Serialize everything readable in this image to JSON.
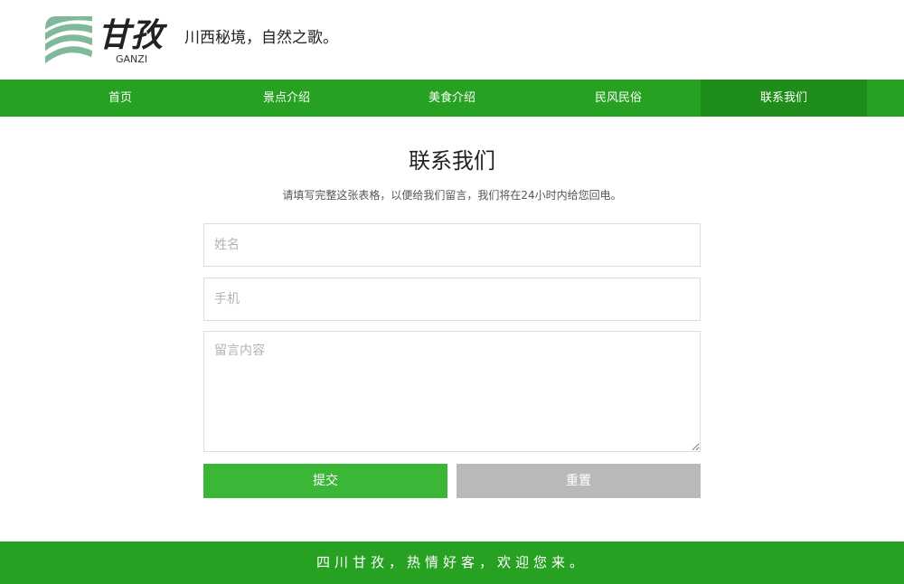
{
  "header": {
    "logo_text": "甘孜",
    "logo_sub": "GANZI",
    "slogan": "川西秘境，自然之歌。"
  },
  "nav": {
    "items": [
      {
        "label": "首页"
      },
      {
        "label": "景点介绍"
      },
      {
        "label": "美食介绍"
      },
      {
        "label": "民风民俗"
      },
      {
        "label": "联系我们"
      }
    ]
  },
  "main": {
    "title": "联系我们",
    "subtitle": "请填写完整这张表格，以便给我们留言，我们将在24小时内给您回电。"
  },
  "form": {
    "name_placeholder": "姓名",
    "phone_placeholder": "手机",
    "message_placeholder": "留言内容",
    "submit_label": "提交",
    "reset_label": "重置"
  },
  "footer": {
    "text": "四川甘孜，热情好客，欢迎您来。"
  },
  "colors": {
    "brand_green": "#27a122",
    "nav_active": "#1f8d1a",
    "submit_green": "#3cb637",
    "reset_gray": "#b9b9b9",
    "logo_mark_green": "#7fb99a"
  }
}
